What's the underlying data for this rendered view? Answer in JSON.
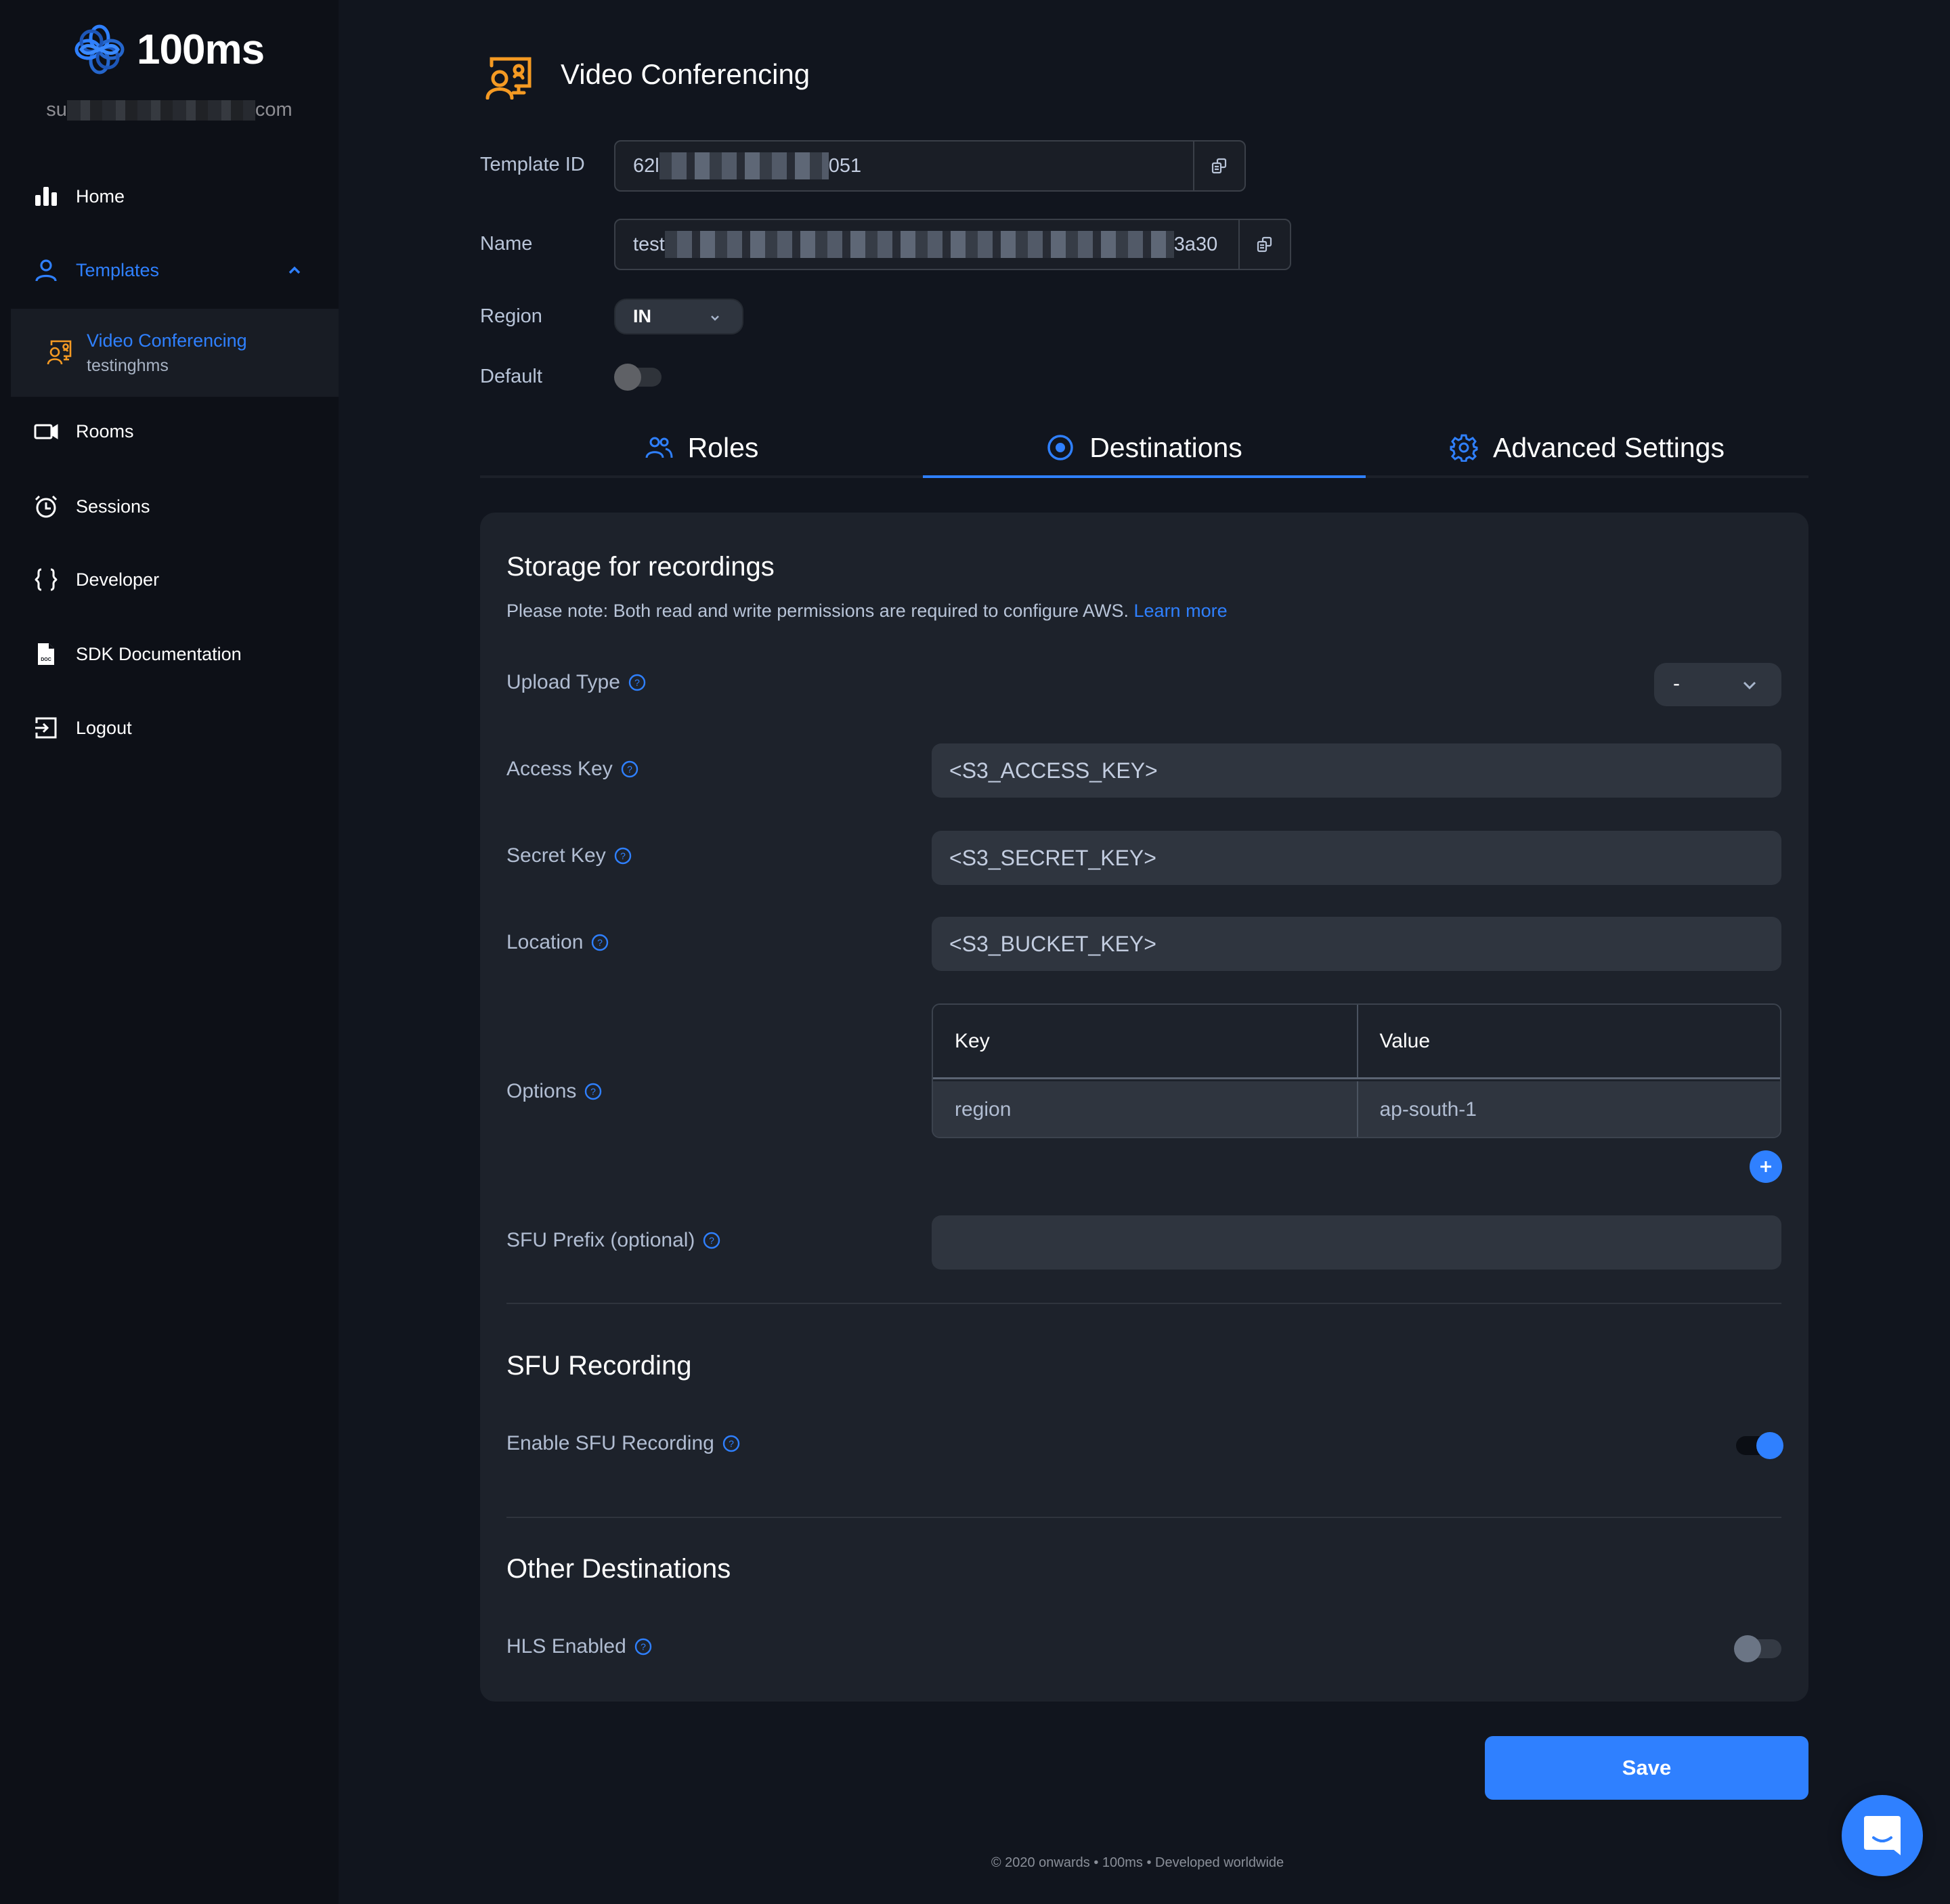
{
  "brand": {
    "name": "100ms",
    "email_prefix": "su",
    "email_suffix": "com"
  },
  "sidebar": {
    "items": [
      {
        "label": "Home",
        "icon": "bar-chart-icon"
      },
      {
        "label": "Templates",
        "icon": "user-icon",
        "expanded": true
      },
      {
        "label": "Rooms",
        "icon": "video-camera-icon"
      },
      {
        "label": "Sessions",
        "icon": "alarm-clock-icon"
      },
      {
        "label": "Developer",
        "icon": "curly-braces-icon"
      },
      {
        "label": "SDK Documentation",
        "icon": "doc-file-icon"
      },
      {
        "label": "Logout",
        "icon": "logout-icon"
      }
    ],
    "active_template": {
      "title": "Video Conferencing",
      "subtitle": "testinghms",
      "icon": "presenter-icon"
    }
  },
  "header": {
    "title": "Video Conferencing",
    "template_id_label": "Template ID",
    "template_id_prefix": "62l",
    "template_id_suffix": "051",
    "name_label": "Name",
    "name_prefix": "test",
    "name_suffix": "3a30",
    "region_label": "Region",
    "region_value": "IN",
    "default_label": "Default",
    "default_enabled": false
  },
  "tabs": [
    {
      "label": "Roles",
      "icon": "users-icon",
      "active": false
    },
    {
      "label": "Destinations",
      "icon": "target-icon",
      "active": true
    },
    {
      "label": "Advanced Settings",
      "icon": "gear-icon",
      "active": false
    }
  ],
  "storage": {
    "heading": "Storage for recordings",
    "note": "Please note: Both read and write permissions are required to configure AWS.",
    "learn_more": "Learn more",
    "upload_type_label": "Upload Type",
    "upload_type_value": "-",
    "access_key_label": "Access Key",
    "access_key_placeholder": "<S3_ACCESS_KEY>",
    "secret_key_label": "Secret Key",
    "secret_key_placeholder": "<S3_SECRET_KEY>",
    "location_label": "Location",
    "location_placeholder": "<S3_BUCKET_KEY>",
    "options_label": "Options",
    "options_table": {
      "headers": [
        "Key",
        "Value"
      ],
      "rows": [
        [
          "region",
          "ap-south-1"
        ]
      ]
    },
    "sfu_prefix_label": "SFU Prefix (optional)",
    "sfu_prefix_value": ""
  },
  "sfu_recording": {
    "heading": "SFU Recording",
    "enable_label": "Enable SFU Recording",
    "enabled": true
  },
  "other_destinations": {
    "heading": "Other Destinations",
    "hls_label": "HLS Enabled",
    "hls_enabled": false
  },
  "actions": {
    "save_label": "Save"
  },
  "footer": {
    "text": "© 2020 onwards • 100ms • Developed worldwide"
  },
  "colors": {
    "accent": "#2f80ff",
    "template_icon": "#f59a23",
    "sidebar_bg": "#0d1017",
    "main_bg": "#11151e",
    "card_bg": "#1d222b"
  }
}
